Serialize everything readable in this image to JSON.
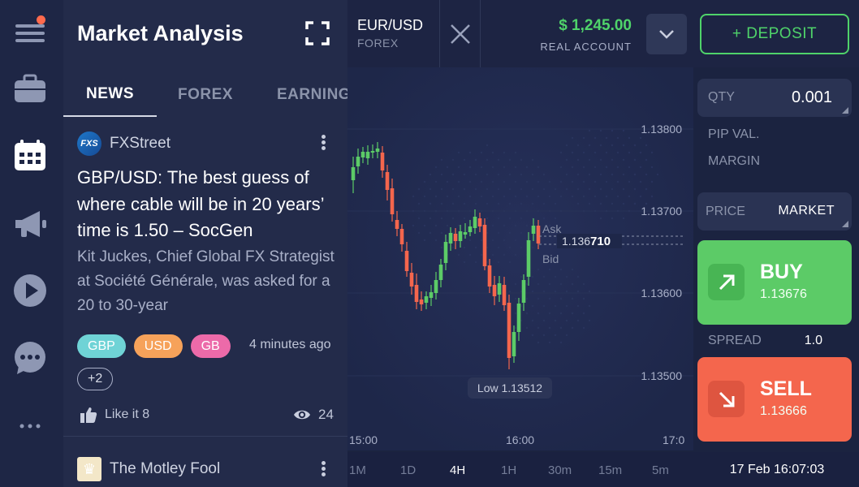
{
  "news_panel": {
    "title": "Market Analysis",
    "tabs": [
      {
        "label": "NEWS",
        "active": true
      },
      {
        "label": "FOREX",
        "active": false
      },
      {
        "label": "EARNINGS",
        "active": false
      }
    ],
    "article": {
      "source": "FXStreet",
      "source_logo_text": "FXS",
      "headline": "GBP/USD: The best guess of where cable will be in 20 years’ time is 1.50 – SocGen",
      "summary": "Kit Juckes, Chief Global FX Strategist at Société Générale, was asked for a 20 to 30-year",
      "tags": [
        {
          "label": "GBP",
          "color": "#6fd3d6"
        },
        {
          "label": "USD",
          "color": "#f6a25a"
        },
        {
          "label": "GB",
          "color": "#ec6aa9"
        }
      ],
      "more_tags": "+2",
      "time_ago": "4 minutes ago",
      "likes": "Like it 8",
      "views": "24"
    },
    "article2": {
      "source": "The Motley Fool"
    }
  },
  "topbar": {
    "pair": "EUR/USD",
    "category": "FOREX",
    "balance": "$ 1,245.00",
    "account_type": "REAL ACCOUNT",
    "deposit_label": "+ DEPOSIT"
  },
  "chart": {
    "price_ticks": [
      "1.13800",
      "1.13700",
      "1.13600",
      "1.13500"
    ],
    "time_ticks": [
      "15:00",
      "16:00",
      "17:0"
    ],
    "ask_label": "Ask",
    "bid_label": "Bid",
    "current_price_prefix": "1.136",
    "current_price_suffix": "710",
    "low_label": "Low 1.13512"
  },
  "timeframes": [
    "1M",
    "1D",
    "4H",
    "1H",
    "30m",
    "15m",
    "5m"
  ],
  "active_timeframe": "4H",
  "trade": {
    "qty_label": "QTY",
    "qty_value": "0.001",
    "pip_label": "PIP VAL.",
    "margin_label": "MARGIN",
    "price_label": "PRICE",
    "price_value": "MARKET",
    "buy_label": "BUY",
    "buy_price": "1.13676",
    "spread_label": "SPREAD",
    "spread_value": "1.0",
    "sell_label": "SELL",
    "sell_price": "1.13666"
  },
  "datetime": "17 Feb 16:07:03",
  "colors": {
    "buy": "#5ccb67",
    "sell": "#f4664d",
    "balance": "#4fd36a",
    "bull_candle": "#5ccb67",
    "bear_candle": "#f4664d"
  }
}
